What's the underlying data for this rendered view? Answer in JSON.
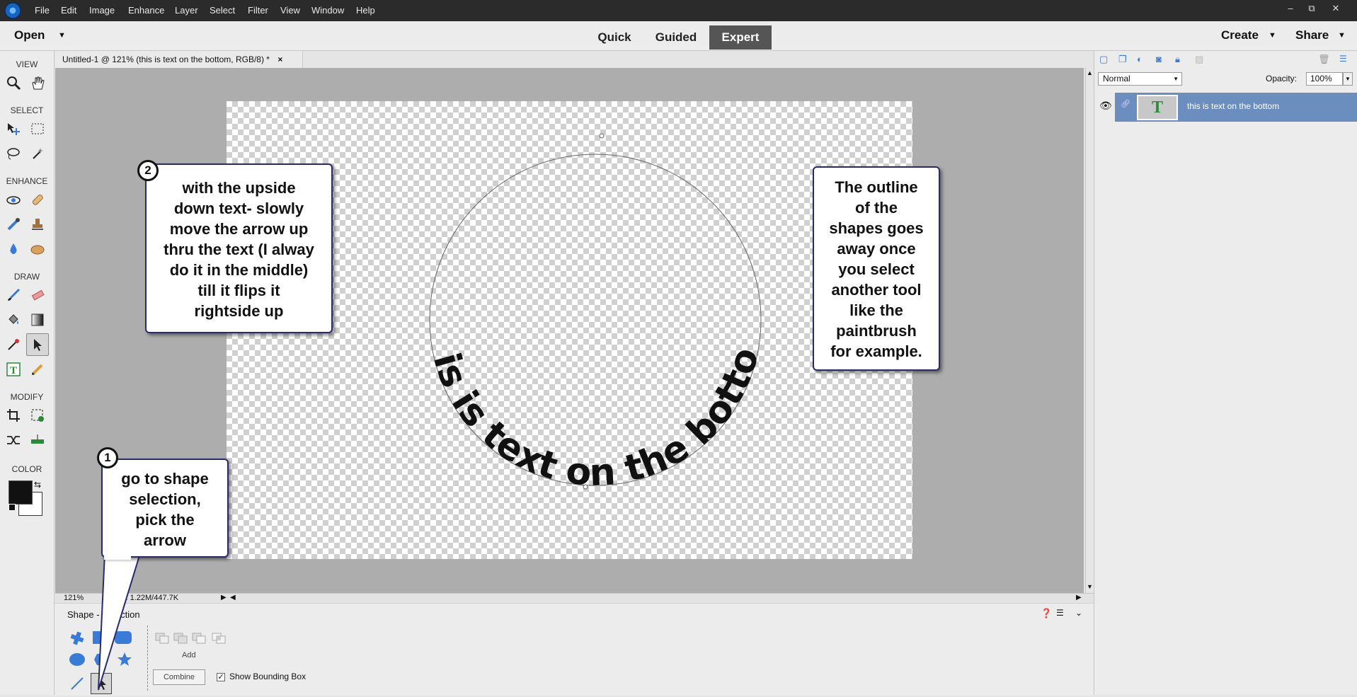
{
  "menu": [
    "File",
    "Edit",
    "Image",
    "Enhance",
    "Layer",
    "Select",
    "Filter",
    "View",
    "Window",
    "Help"
  ],
  "window_controls": {
    "minimize": "–",
    "restore": "⧉",
    "close": "✕"
  },
  "modebar": {
    "open_label": "Open",
    "modes": [
      "Quick",
      "Guided",
      "Expert"
    ],
    "active_mode": "Expert",
    "create_label": "Create",
    "share_label": "Share"
  },
  "toolbar": {
    "sections": [
      "VIEW",
      "SELECT",
      "ENHANCE",
      "DRAW",
      "MODIFY",
      "COLOR"
    ]
  },
  "doc_tab": {
    "title": "Untitled-1 @ 121% (this is text on the bottom, RGB/8) *",
    "close": "×"
  },
  "canvas": {
    "curved_text": "this is text on the bottom"
  },
  "status": {
    "zoom": "121%",
    "doc_size": "c: 1.22M/447.7K"
  },
  "options": {
    "title": "Shape - Selection",
    "add_label": "Add",
    "combine_label": "Combine",
    "show_bbox_label": "Show Bounding Box",
    "show_bbox_checked": true
  },
  "layers": {
    "blend_mode": "Normal",
    "opacity_label": "Opacity:",
    "opacity_value": "100%",
    "layer_name": "this is text on the bottom",
    "layer_glyph": "T"
  },
  "callouts": {
    "one": {
      "badge": "1",
      "lines": [
        "go to shape",
        "selection,",
        "pick the",
        "arrow"
      ]
    },
    "two": {
      "badge": "2",
      "lines": [
        "with the upside",
        "down text- slowly",
        "move the arrow up",
        "thru the text (I alway",
        "do it in the middle)",
        "till it flips it",
        "rightside up"
      ]
    },
    "three": {
      "lines": [
        "The outline",
        "of the",
        "shapes goes",
        "away once",
        "you select",
        "another tool",
        "like the",
        "paintbrush",
        "for example."
      ]
    }
  },
  "colors": {
    "titlebar": "#2b2b2b",
    "layer_selected": "#6c8ebf",
    "callout_border": "#2a2a6a",
    "expert_active": "#555555"
  }
}
